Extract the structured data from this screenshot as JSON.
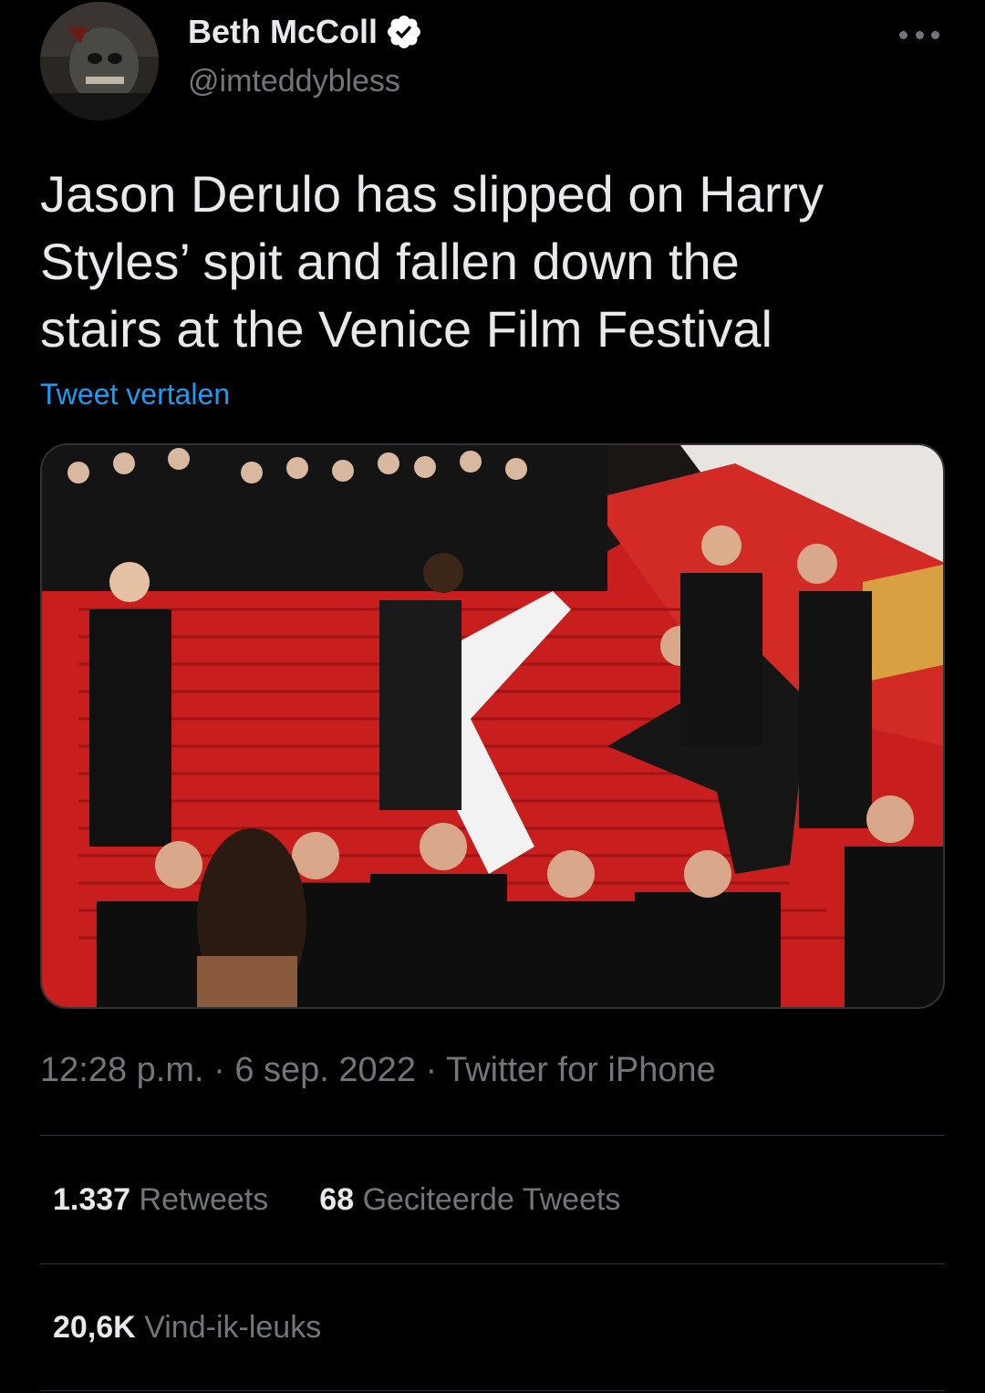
{
  "author": {
    "display_name": "Beth McColl",
    "handle": "@imteddybless",
    "verified_icon": "verified-badge-icon"
  },
  "tweet": {
    "text": "Jason Derulo has slipped on Harry\nStyles’ spit and fallen down the\nstairs at the Venice Film Festival",
    "translate_label": "Tweet vertalen"
  },
  "meta": {
    "time": "12:28 p.m.",
    "sep1": " · ",
    "date": "6 sep. 2022",
    "sep2": " · ",
    "source": "Twitter for iPhone"
  },
  "stats": {
    "retweets_count": "1.337",
    "retweets_label": "Retweets",
    "quotes_count": "68",
    "quotes_label": "Geciteerde Tweets",
    "likes_count": "20,6K",
    "likes_label": "Vind-ik-leuks"
  },
  "colors": {
    "background": "#000000",
    "text": "#e7e9ea",
    "muted": "#71767b",
    "link": "#1d9bf0",
    "verified": "#ffffff"
  }
}
